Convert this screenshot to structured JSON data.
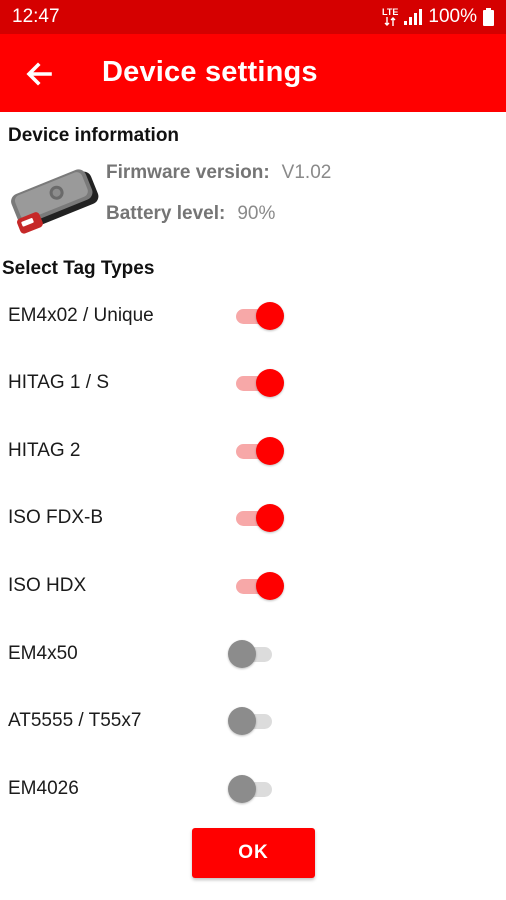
{
  "status_bar": {
    "time": "12:47",
    "network_icon": "lte-icon",
    "signal_icon": "cellular-signal-icon",
    "battery_text": "100%",
    "battery_icon": "battery-full-icon",
    "lte_label": "LTE"
  },
  "app_bar": {
    "back_icon": "arrow-back-icon",
    "title": "Device settings",
    "color": "#ff0000"
  },
  "device_info": {
    "section_title": "Device information",
    "firmware_label": "Firmware version:",
    "firmware_value": "V1.02",
    "battery_label": "Battery level:",
    "battery_value": "90%"
  },
  "tag_types": {
    "section_title": "Select Tag Types",
    "items": [
      {
        "label": "EM4x02 / Unique",
        "enabled": true
      },
      {
        "label": "HITAG 1 / S",
        "enabled": true
      },
      {
        "label": "HITAG 2",
        "enabled": true
      },
      {
        "label": "ISO FDX-B",
        "enabled": true
      },
      {
        "label": "ISO HDX",
        "enabled": true
      },
      {
        "label": "EM4x50",
        "enabled": false
      },
      {
        "label": "AT5555 / T55x7",
        "enabled": false
      },
      {
        "label": "EM4026",
        "enabled": false
      }
    ]
  },
  "ok_button": {
    "label": "OK"
  }
}
